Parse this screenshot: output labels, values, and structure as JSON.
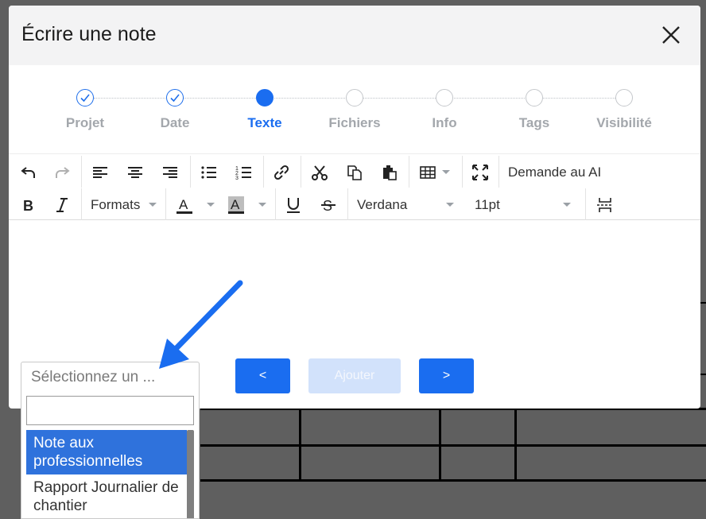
{
  "modal": {
    "title": "Écrire une note",
    "close_icon": "close-icon"
  },
  "stepper": {
    "steps": [
      {
        "label": "Projet",
        "state": "done"
      },
      {
        "label": "Date",
        "state": "done"
      },
      {
        "label": "Texte",
        "state": "active"
      },
      {
        "label": "Fichiers",
        "state": "pending"
      },
      {
        "label": "Info",
        "state": "pending"
      },
      {
        "label": "Tags",
        "state": "pending"
      },
      {
        "label": "Visibilité",
        "state": "pending"
      }
    ]
  },
  "toolbar": {
    "ai_label": "Demande au AI",
    "formats_label": "Formats",
    "font_family": "Verdana",
    "font_size": "11pt",
    "icons": [
      "undo-icon",
      "redo-icon",
      "align-left-icon",
      "align-center-icon",
      "align-right-icon",
      "bullet-list-icon",
      "numbered-list-icon",
      "link-icon",
      "cut-icon",
      "copy-icon",
      "paste-icon",
      "table-icon",
      "fullscreen-icon",
      "bold-icon",
      "italic-icon",
      "text-color-icon",
      "highlight-color-icon",
      "underline-icon",
      "strikethrough-icon",
      "page-break-icon"
    ]
  },
  "buttons": {
    "prev": "<",
    "add": "Ajouter",
    "next": ">"
  },
  "select": {
    "placeholder": "Sélectionnez un ...",
    "search_value": "",
    "options": [
      "Note aux professionnelles",
      "Rapport Journalier de chantier"
    ]
  },
  "colors": {
    "accent": "#1a6df0",
    "disabled_button": "#d2e2fb",
    "highlight_option": "#2f72dc",
    "overlay": "#5f5f5f"
  }
}
